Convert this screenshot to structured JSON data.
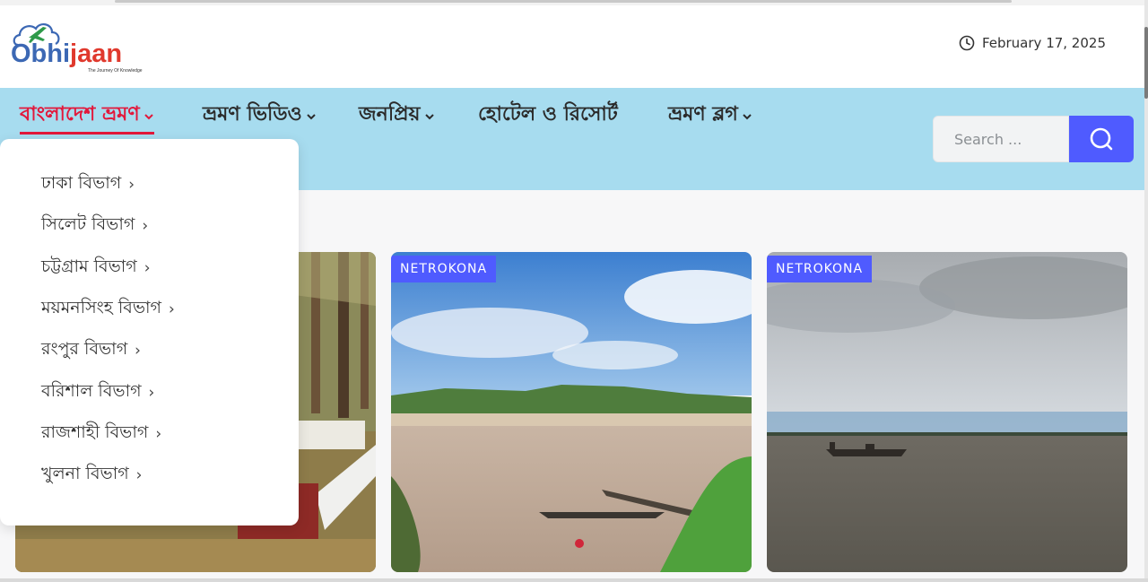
{
  "logo": {
    "part1": "Obhi",
    "part2": "jaan",
    "tagline": "The Journey Of Knowledge"
  },
  "date": "February 17, 2025",
  "nav": {
    "items": [
      {
        "label": "বাংলাদেশ ভ্রমণ",
        "active": true,
        "has_dropdown": true
      },
      {
        "label": "ভ্রমণ ভিডিও",
        "active": false,
        "has_dropdown": true
      },
      {
        "label": "জনপ্রিয়",
        "active": false,
        "has_dropdown": true
      },
      {
        "label": "হোটেল ও রিসোর্ট",
        "active": false,
        "has_dropdown": false
      },
      {
        "label": "ভ্রমণ ব্লগ",
        "active": false,
        "has_dropdown": true
      }
    ]
  },
  "search": {
    "placeholder": "Search ..."
  },
  "dropdown": {
    "items": [
      "ঢাকা বিভাগ",
      "সিলেট বিভাগ",
      "চট্টগ্রাম বিভাগ",
      "ময়মনসিংহ বিভাগ",
      "রংপুর বিভাগ",
      "বরিশাল বিভাগ",
      "রাজশাহী বিভাগ",
      "খুলনা বিভাগ"
    ],
    "arrow": "›"
  },
  "cards": [
    {
      "badge": ""
    },
    {
      "badge": "NETROKONA"
    },
    {
      "badge": "NETROKONA"
    }
  ],
  "colors": {
    "accent": "#4f5bff",
    "nav_bg": "#a7dcef",
    "active": "#e2183b"
  }
}
